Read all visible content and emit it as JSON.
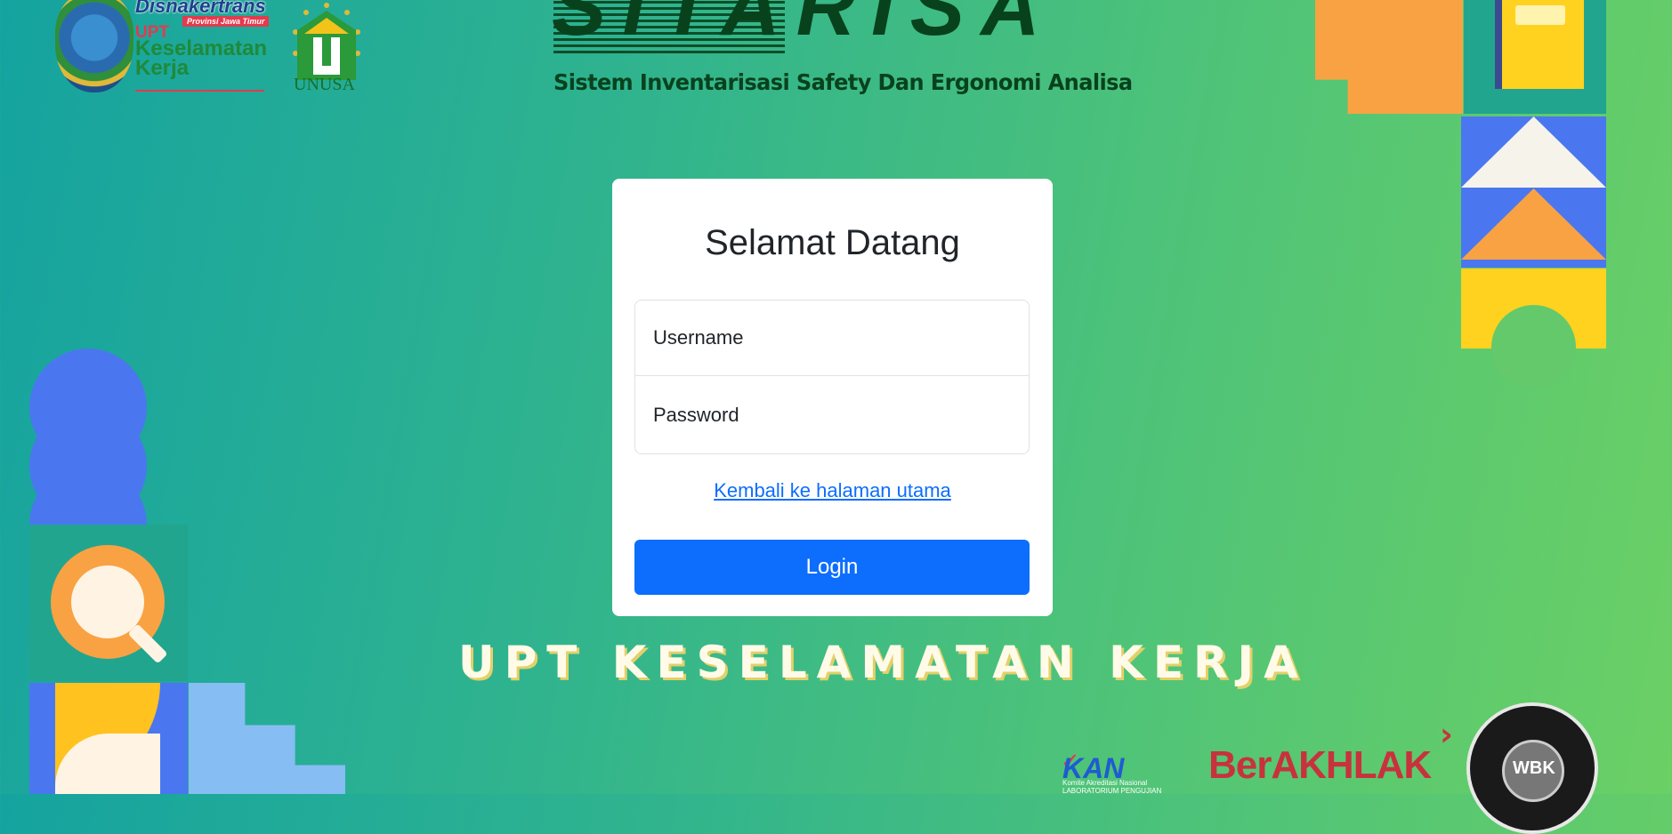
{
  "header": {
    "brand": "SITARISA",
    "subtitle": "Sistem Inventarisasi Safety Dan Ergonomi Analisa"
  },
  "logos": {
    "disnakertrans": "Disnakertrans",
    "province": "Provinsi Jawa Timur",
    "upt": "UPT",
    "keselamatan_kerja": "Keselamatan Kerja",
    "unjsa": "UNUSA",
    "kan": "KAN",
    "kan_sub": "Komite Akreditasi Nasional LABORATORIUM PENGUJIAN",
    "berakhlak": "BerAKHLAK",
    "wbk": "WBK"
  },
  "login": {
    "title": "Selamat Datang",
    "username_placeholder": "Username",
    "password_placeholder": "Password",
    "back_link": "Kembali ke halaman utama",
    "login_button": "Login"
  },
  "tagline": "UPT KESELAMATAN KERJA",
  "colors": {
    "primary": "#0d6efd",
    "brand_dark": "#08421d",
    "background_start": "#15a3a0",
    "background_end": "#6bd065"
  }
}
